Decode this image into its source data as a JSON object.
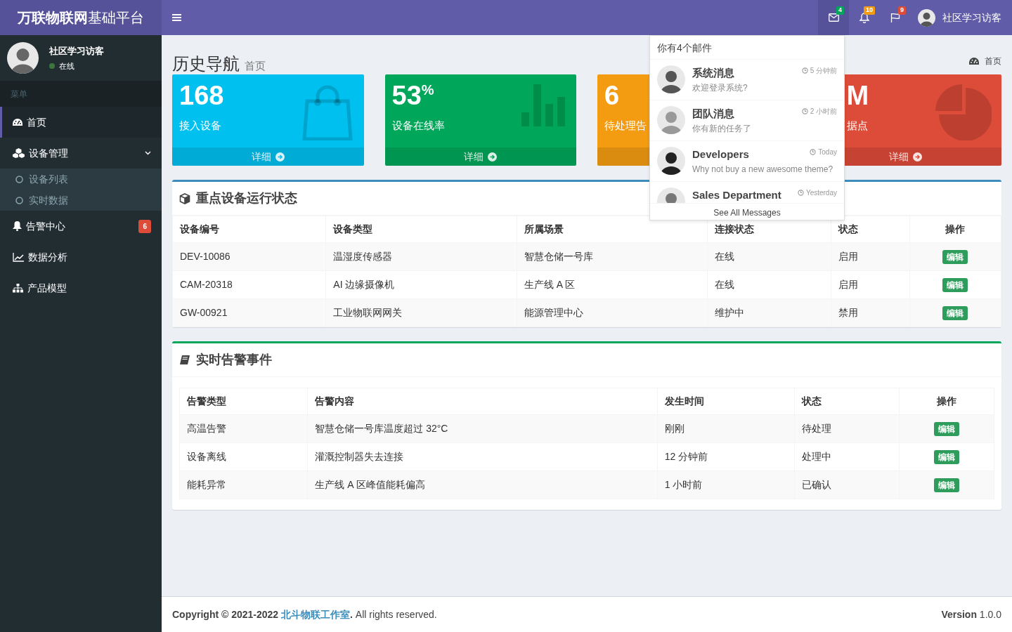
{
  "brand": {
    "bold": "万联物联网",
    "light": "基础平台"
  },
  "navbar": {
    "items": [
      {
        "badge": "4",
        "color": "#00a65a",
        "selected": true
      },
      {
        "badge": "10",
        "color": "#f39c12",
        "selected": false
      },
      {
        "badge": "9",
        "color": "#dd4b39",
        "selected": false
      }
    ],
    "user": "社区学习访客"
  },
  "mail_dropdown": {
    "header": "你有4个邮件",
    "messages": [
      {
        "from": "系统消息",
        "time": "5 分钟前",
        "text": "欢迎登录系统?"
      },
      {
        "from": "团队消息",
        "time": "2 小时前",
        "text": "你有新的任务了"
      },
      {
        "from": "Developers",
        "time": "Today",
        "text": "Why not buy a new awesome theme?"
      },
      {
        "from": "Sales Department",
        "time": "Yesterday"
      }
    ],
    "footer": "See All Messages"
  },
  "sidebar": {
    "user": {
      "name": "社区学习访客",
      "status": "在线"
    },
    "header": "菜单",
    "items": [
      {
        "label": "首页",
        "selected": true
      },
      {
        "label": "设备管理",
        "selected": false,
        "expanded": true,
        "children": [
          {
            "label": "设备列表"
          },
          {
            "label": "实时数据"
          }
        ]
      },
      {
        "label": "告警中心",
        "selected": false,
        "badge": "6"
      },
      {
        "label": "数据分析",
        "selected": false
      },
      {
        "label": "产品模型",
        "selected": false
      }
    ]
  },
  "page_header": {
    "title": "历史导航",
    "subtitle": "首页",
    "breadcrumb": "首页"
  },
  "stat_boxes": [
    {
      "value": "168",
      "label": "接入设备",
      "footer": "详细",
      "color": "#00c0ef"
    },
    {
      "value": "53$^{%}$",
      "label": "设备在线率",
      "footer": "详细",
      "color": "#00a65a"
    },
    {
      "value": "6",
      "label": "待处理告",
      "color": "#f39c12"
    },
    {
      "value": "M",
      "label": "据点",
      "footer": "详细",
      "color": "#dd4b39"
    }
  ],
  "device_table": {
    "title": "重点设备运行状态",
    "columns": [
      "设备编号",
      "设备类型",
      "所属场景",
      "连接状态",
      "状态",
      "操作"
    ],
    "rows": [
      [
        "DEV-10086",
        "温湿度传感器",
        "智慧仓储一号库",
        "在线",
        "启用",
        "编辑"
      ],
      [
        "CAM-20318",
        "AI 边缘摄像机",
        "生产线 A 区",
        "在线",
        "启用",
        "编辑"
      ],
      [
        "GW-00921",
        "工业物联网网关",
        "能源管理中心",
        "维护中",
        "禁用",
        "编辑"
      ]
    ]
  },
  "alarm_table": {
    "title": "实时告警事件",
    "columns": [
      "告警类型",
      "告警内容",
      "发生时间",
      "状态",
      "操作"
    ],
    "rows": [
      [
        "高温告警",
        "智慧仓储一号库温度超过 32°C",
        "刚刚",
        "待处理",
        "编辑"
      ],
      [
        "设备离线",
        "灌溉控制器失去连接",
        "12 分钟前",
        "处理中",
        "编辑"
      ],
      [
        "能耗异常",
        "生产线 A 区峰值能耗偏高",
        "1 小时前",
        "已确认",
        "编辑"
      ]
    ]
  },
  "footer": {
    "copyright": "**Copyright © 2021-2022** ",
    "link": "北斗物联工作室",
    "rest": "**.** All rights reserved.",
    "version": "**Version** 1.0.0"
  }
}
